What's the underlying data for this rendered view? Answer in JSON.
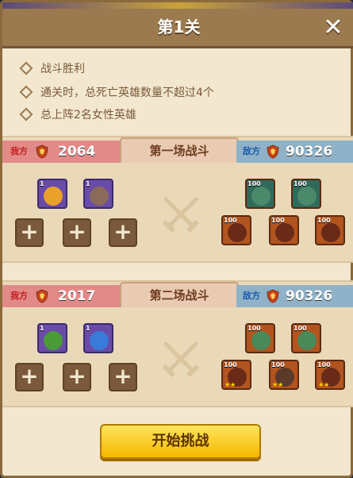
{
  "header": {
    "title": "第1关",
    "close_label": "✕"
  },
  "conditions": [
    "战斗胜利",
    "通关时，总死亡英雄数量不超过4个",
    "总上阵2名女性英雄"
  ],
  "battles": [
    {
      "label": "第一场战斗",
      "my_label": "我方",
      "my_power": "2064",
      "enemy_label": "敌方",
      "enemy_power": "90326",
      "my_heroes": [
        {
          "lvl": "1"
        },
        {
          "lvl": "1"
        }
      ],
      "enemy_heroes": [
        {
          "lvl": "100"
        },
        {
          "lvl": "100"
        },
        {
          "lvl": "100"
        },
        {
          "lvl": "100"
        },
        {
          "lvl": "100"
        }
      ]
    },
    {
      "label": "第二场战斗",
      "my_label": "我方",
      "my_power": "2017",
      "enemy_label": "敌方",
      "enemy_power": "90326",
      "my_heroes": [
        {
          "lvl": "1"
        },
        {
          "lvl": "1"
        }
      ],
      "enemy_heroes": [
        {
          "lvl": "100"
        },
        {
          "lvl": "100"
        },
        {
          "lvl": "100"
        },
        {
          "lvl": "100"
        },
        {
          "lvl": "100"
        }
      ]
    }
  ],
  "add_slot_label": "+",
  "start_button": "开始挑战",
  "colors": {
    "accent": "#f4b800",
    "mine": "#e28a88",
    "enemy": "#8fb2c8"
  }
}
